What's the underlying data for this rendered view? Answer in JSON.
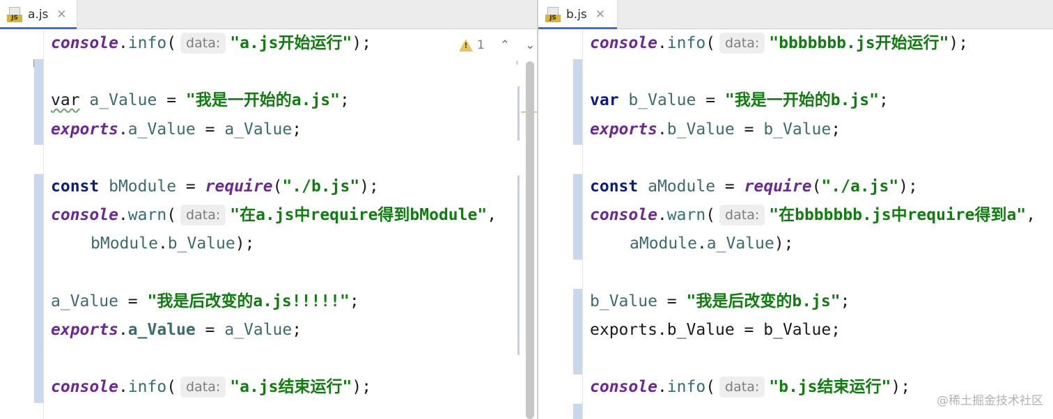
{
  "left": {
    "tab": {
      "icon": "js-file-icon",
      "badge": "JS",
      "label": "a.js",
      "close": "✕"
    },
    "inspection": {
      "count": "1",
      "up": "⌃",
      "down": "⌄"
    },
    "lines": [
      [
        [
          "it",
          "console"
        ],
        [
          "punc",
          "."
        ],
        [
          "meth",
          "info"
        ],
        [
          "punc",
          "("
        ],
        [
          "hint",
          "data:"
        ],
        [
          "str",
          "\"a.js开始运行\""
        ],
        [
          "punc",
          ");"
        ]
      ],
      [],
      [
        [
          "kw-squig",
          "var"
        ],
        [
          "plain",
          " "
        ],
        [
          "ident",
          "a_Value"
        ],
        [
          "plain",
          " "
        ],
        [
          "punc",
          "="
        ],
        [
          "plain",
          " "
        ],
        [
          "str",
          "\"我是一开始的a.js\""
        ],
        [
          "punc",
          ";"
        ]
      ],
      [
        [
          "it",
          "exports"
        ],
        [
          "punc",
          "."
        ],
        [
          "ident",
          "a_Value"
        ],
        [
          "plain",
          " "
        ],
        [
          "punc",
          "="
        ],
        [
          "plain",
          " "
        ],
        [
          "ident",
          "a_Value"
        ],
        [
          "punc",
          ";"
        ]
      ],
      [],
      [
        [
          "kw",
          "const"
        ],
        [
          "plain",
          " "
        ],
        [
          "ident",
          "bModule"
        ],
        [
          "plain",
          " "
        ],
        [
          "punc",
          "="
        ],
        [
          "plain",
          " "
        ],
        [
          "it",
          "require"
        ],
        [
          "punc",
          "("
        ],
        [
          "str",
          "\"./b.js\""
        ],
        [
          "punc",
          ");"
        ]
      ],
      [
        [
          "it",
          "console"
        ],
        [
          "punc",
          "."
        ],
        [
          "meth",
          "warn"
        ],
        [
          "punc",
          "("
        ],
        [
          "hint",
          "data:"
        ],
        [
          "str",
          "\"在a.js中require得到bModule\""
        ],
        [
          "punc",
          ","
        ]
      ],
      [
        [
          "ind",
          ""
        ],
        [
          "ident",
          "bModule"
        ],
        [
          "punc",
          "."
        ],
        [
          "ident",
          "b_Value"
        ],
        [
          "punc",
          ");"
        ]
      ],
      [],
      [
        [
          "ident",
          "a_Value"
        ],
        [
          "plain",
          " "
        ],
        [
          "punc",
          "="
        ],
        [
          "plain",
          " "
        ],
        [
          "str",
          "\"我是后改变的a.js!!!!!\""
        ],
        [
          "punc",
          ";"
        ]
      ],
      [
        [
          "it",
          "exports"
        ],
        [
          "punc",
          "."
        ],
        [
          "boldid",
          "a_Value"
        ],
        [
          "plain",
          " "
        ],
        [
          "punc",
          "="
        ],
        [
          "plain",
          " "
        ],
        [
          "ident",
          "a_Value"
        ],
        [
          "punc",
          ";"
        ]
      ],
      [],
      [
        [
          "it",
          "console"
        ],
        [
          "punc",
          "."
        ],
        [
          "meth",
          "info"
        ],
        [
          "punc",
          "("
        ],
        [
          "hint",
          "data:"
        ],
        [
          "str",
          "\"a.js结束运行\""
        ],
        [
          "punc",
          ");"
        ]
      ]
    ]
  },
  "right": {
    "tab": {
      "icon": "js-file-icon",
      "badge": "JS",
      "label": "b.js",
      "close": "✕"
    },
    "lines": [
      [
        [
          "it",
          "console"
        ],
        [
          "punc",
          "."
        ],
        [
          "meth",
          "info"
        ],
        [
          "punc",
          "("
        ],
        [
          "hint",
          "data:"
        ],
        [
          "str",
          "\"bbbbbbb.js开始运行\""
        ],
        [
          "punc",
          ");"
        ]
      ],
      [],
      [
        [
          "kw",
          "var"
        ],
        [
          "plain",
          " "
        ],
        [
          "ident",
          "b_Value"
        ],
        [
          "plain",
          " "
        ],
        [
          "punc",
          "="
        ],
        [
          "plain",
          " "
        ],
        [
          "str",
          "\"我是一开始的b.js\""
        ],
        [
          "punc",
          ";"
        ]
      ],
      [
        [
          "it",
          "exports"
        ],
        [
          "punc",
          "."
        ],
        [
          "ident",
          "b_Value"
        ],
        [
          "plain",
          " "
        ],
        [
          "punc",
          "="
        ],
        [
          "plain",
          " "
        ],
        [
          "ident",
          "b_Value"
        ],
        [
          "punc",
          ";"
        ]
      ],
      [],
      [
        [
          "kw",
          "const"
        ],
        [
          "plain",
          " "
        ],
        [
          "ident",
          "aModule"
        ],
        [
          "plain",
          " "
        ],
        [
          "punc",
          "="
        ],
        [
          "plain",
          " "
        ],
        [
          "it",
          "require"
        ],
        [
          "punc",
          "("
        ],
        [
          "str",
          "\"./a.js\""
        ],
        [
          "punc",
          ");"
        ]
      ],
      [
        [
          "it",
          "console"
        ],
        [
          "punc",
          "."
        ],
        [
          "meth",
          "warn"
        ],
        [
          "punc",
          "("
        ],
        [
          "hint",
          "data:"
        ],
        [
          "str",
          "\"在bbbbbbb.js中require得到a\""
        ],
        [
          "punc",
          ","
        ]
      ],
      [
        [
          "ind",
          ""
        ],
        [
          "ident",
          "aModule"
        ],
        [
          "punc",
          "."
        ],
        [
          "ident",
          "a_Value"
        ],
        [
          "punc",
          ");"
        ]
      ],
      [],
      [
        [
          "ident",
          "b_Value"
        ],
        [
          "plain",
          " "
        ],
        [
          "punc",
          "="
        ],
        [
          "plain",
          " "
        ],
        [
          "str",
          "\"我是后改变的b.js\""
        ],
        [
          "punc",
          ";"
        ]
      ],
      [
        [
          "plain",
          "exports.b_Value = b_Value;"
        ]
      ],
      [],
      [
        [
          "it",
          "console"
        ],
        [
          "punc",
          "."
        ],
        [
          "meth",
          "info"
        ],
        [
          "punc",
          "("
        ],
        [
          "hint",
          "data:"
        ],
        [
          "str",
          "\"b.js结束运行\""
        ],
        [
          "punc",
          ");"
        ]
      ]
    ]
  },
  "watermark": "@稀土掘金技术社区",
  "colors": {
    "keyword": "#0a1d7f",
    "italic_bold": "#6b2893",
    "string": "#0e7d0e",
    "identifier": "#3c6b6d",
    "change_marker": "#c9d8ec",
    "tab_active": "#3b73c9"
  }
}
